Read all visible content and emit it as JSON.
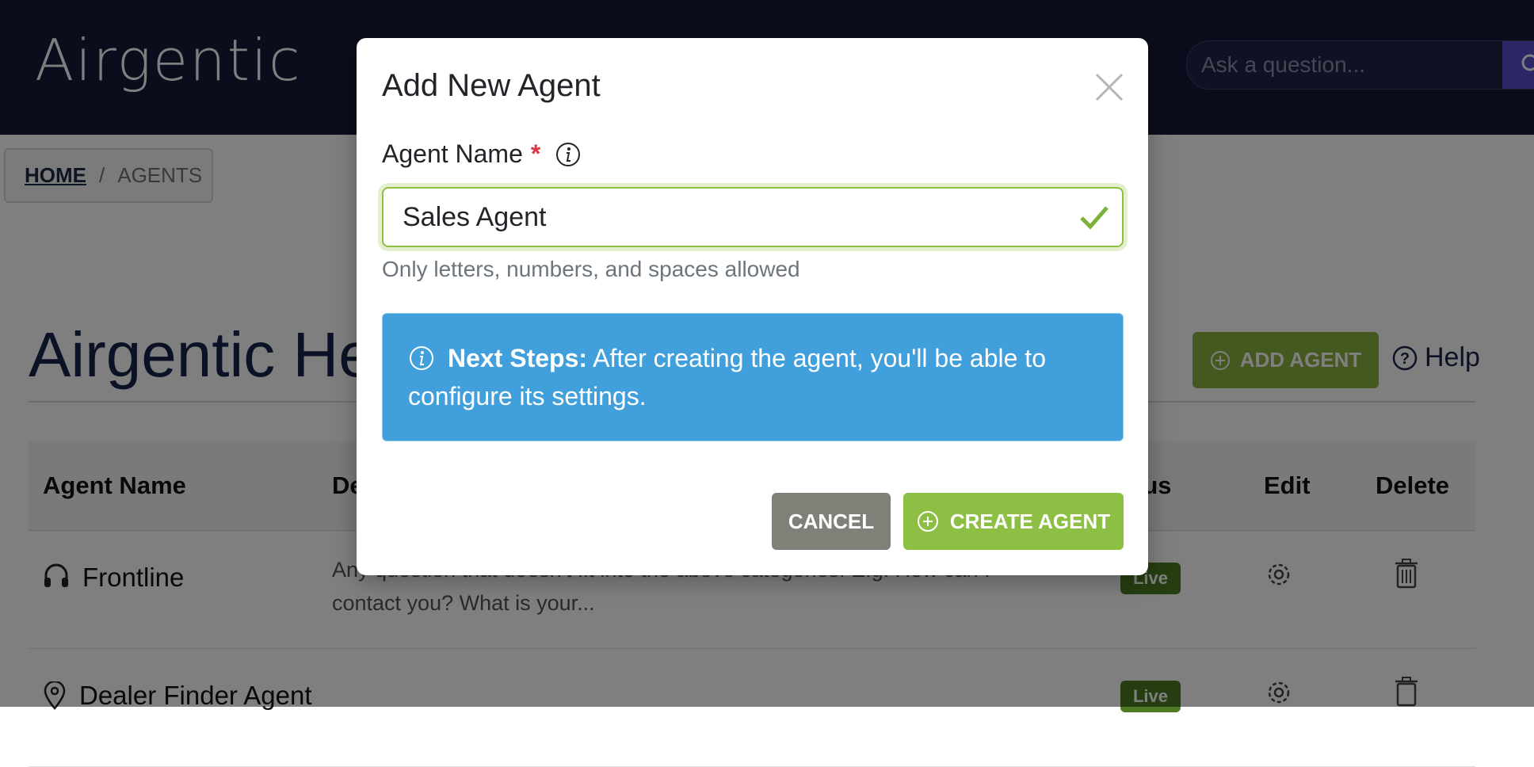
{
  "nav": {
    "logo": "Airgentic",
    "search_placeholder": "Ask a question..."
  },
  "breadcrumb": {
    "home": "HOME",
    "separator": "/",
    "current": "AGENTS"
  },
  "page": {
    "title": "Airgentic Hel",
    "add_agent_label": "ADD AGENT",
    "help_label": "Help"
  },
  "table": {
    "columns": [
      "Agent Name",
      "De",
      "tus",
      "Edit",
      "Delete"
    ],
    "rows": [
      {
        "name": "Frontline",
        "icon": "headset-icon",
        "description": "Any question that doesn't fit into the above categories. E.g. How can I contact you? What is your...",
        "status": "Live"
      },
      {
        "name": "Dealer Finder Agent",
        "icon": "location-pin-icon",
        "description": "",
        "status": "Live"
      }
    ]
  },
  "modal": {
    "title": "Add New Agent",
    "field_label": "Agent Name",
    "required_mark": "*",
    "field_value": "Sales Agent",
    "hint": "Only letters, numbers, and spaces allowed",
    "alert_strong": "Next Steps:",
    "alert_text": " After creating the agent, you'll be able to configure its settings.",
    "cancel_label": "CANCEL",
    "create_label": "CREATE AGENT"
  },
  "colors": {
    "nav_bg": "#161a3a",
    "accent_green": "#8dbf45",
    "info_blue": "#41a0db",
    "required_red": "#dc3545",
    "live_badge": "#4d7a22"
  }
}
